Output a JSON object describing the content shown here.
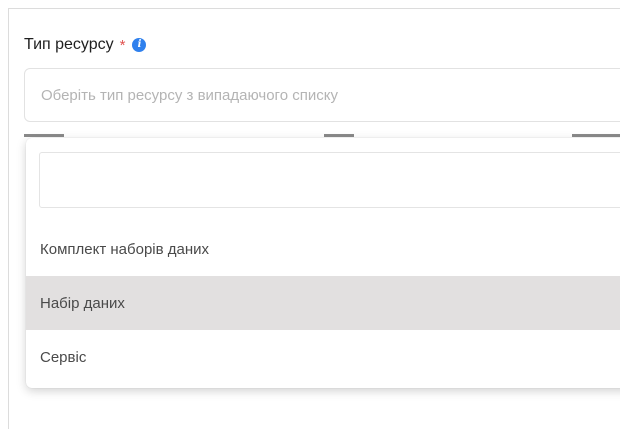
{
  "resource_field": {
    "label": "Тип ресурсу",
    "required_mark": "*",
    "info_icon": "info-icon",
    "placeholder": "Оберіть тип ресурсу з випадаючого списку"
  },
  "dropdown": {
    "search_value": "",
    "highlighted_index": 1,
    "options": [
      {
        "label": "Комплект наборів даних"
      },
      {
        "label": "Набір даних"
      },
      {
        "label": "Сервіс"
      }
    ]
  },
  "colors": {
    "required": "#e0524f",
    "info": "#2f80ed",
    "highlight": "#e2e0e0"
  }
}
